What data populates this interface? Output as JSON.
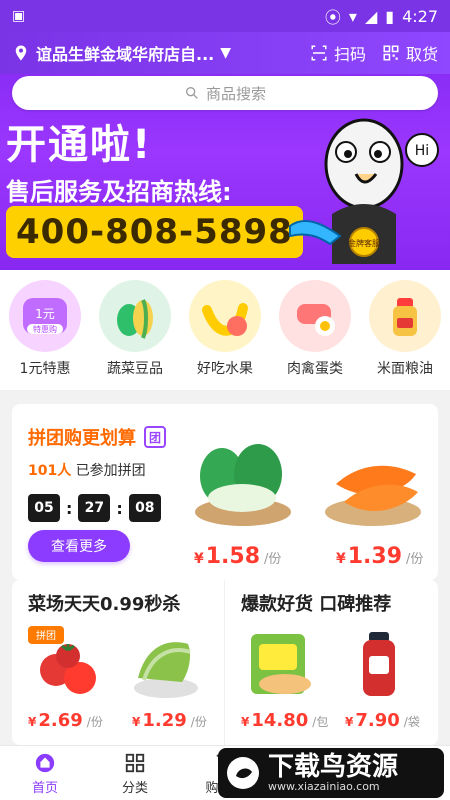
{
  "status_bar": {
    "time": "4:27"
  },
  "header": {
    "store": "谊品生鲜金域华府店自...",
    "scan_label": "扫码",
    "pickup_label": "取货"
  },
  "search": {
    "placeholder": "商品搜索"
  },
  "banner": {
    "headline": "开通啦!",
    "subline": "售后服务及招商热线:",
    "phone": "400-808-5898",
    "badge": "金牌客服",
    "bubble": "Hi"
  },
  "categories": [
    {
      "label": "1元特惠",
      "badge_top": "1元",
      "badge_bottom": "特惠购"
    },
    {
      "label": "蔬菜豆品"
    },
    {
      "label": "好吃水果"
    },
    {
      "label": "肉禽蛋类"
    },
    {
      "label": "米面粮油"
    }
  ],
  "group_buy": {
    "title": "拼团购更划算",
    "badge": "团",
    "joined_count": "101人",
    "joined_suffix": "已参加拼团",
    "timer": {
      "h": "05",
      "m": "27",
      "s": "08"
    },
    "cta": "查看更多",
    "items": [
      {
        "price": "1.58",
        "unit": "/份"
      },
      {
        "price": "1.39",
        "unit": "/份"
      }
    ]
  },
  "promos": {
    "left": {
      "title": "菜场天天0.99秒杀",
      "items": [
        {
          "price": "2.69",
          "unit": "/份",
          "tag": "拼团"
        },
        {
          "price": "1.29",
          "unit": "/份"
        }
      ]
    },
    "right": {
      "title": "爆款好货 口碑推荐",
      "items": [
        {
          "price": "14.80",
          "unit": "/包"
        },
        {
          "price": "7.90",
          "unit": "/袋"
        }
      ]
    }
  },
  "tabs": [
    {
      "label": "首页"
    },
    {
      "label": "分类"
    },
    {
      "label": "购物车"
    }
  ],
  "watermark": {
    "brand": "下载鸟资源",
    "site": "www.xiazainiao.com"
  },
  "colors": {
    "brand": "#8b3cff",
    "price": "#ff3b30",
    "accent": "#ff6a00"
  }
}
